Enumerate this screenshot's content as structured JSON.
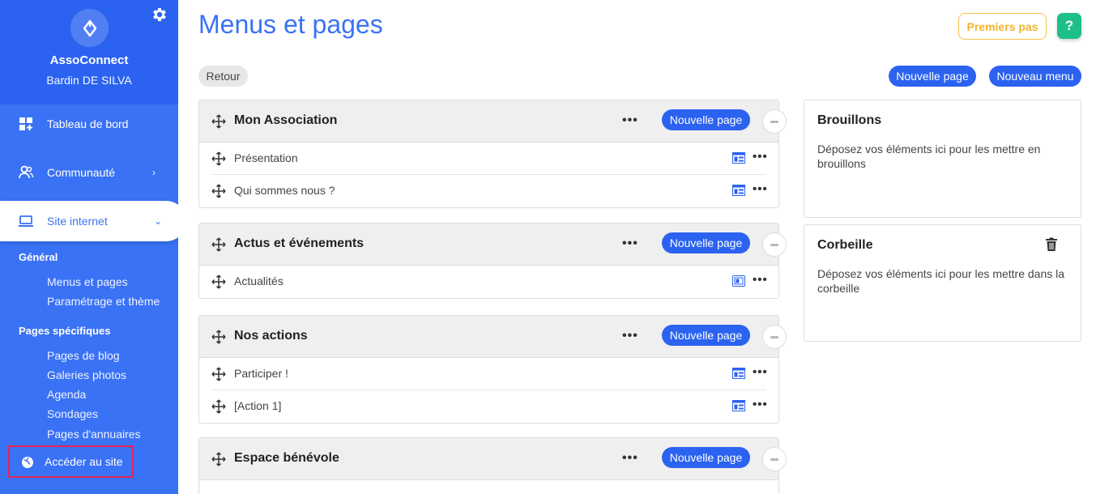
{
  "sidebar": {
    "org_name": "AssoConnect",
    "user_name": "Bardin DE SILVA",
    "nav": [
      {
        "label": "Tableau de bord",
        "icon": "dashboard-icon"
      },
      {
        "label": "Communauté",
        "icon": "community-icon"
      },
      {
        "label": "Site internet",
        "icon": "laptop-icon"
      }
    ],
    "section_general": "Général",
    "general_items": [
      "Menus et pages",
      "Paramétrage et thème"
    ],
    "section_specific": "Pages spécifiques",
    "specific_items": [
      "Pages de blog",
      "Galeries photos",
      "Agenda",
      "Sondages",
      "Pages d'annuaires"
    ],
    "visit_site": "Accéder au site"
  },
  "header": {
    "title": "Menus et pages",
    "first_steps": "Premiers pas",
    "help": "?"
  },
  "toolbar": {
    "back": "Retour",
    "new_page": "Nouvelle page",
    "new_menu": "Nouveau menu"
  },
  "menus": [
    {
      "title": "Mon Association",
      "add_label": "Nouvelle page",
      "pages": [
        "Présentation",
        "Qui sommes nous ?"
      ]
    },
    {
      "title": "Actus et événements",
      "add_label": "Nouvelle page",
      "pages": [
        "Actualités"
      ]
    },
    {
      "title": "Nos actions",
      "add_label": "Nouvelle page",
      "pages": [
        "Participer !",
        "[Action 1]"
      ]
    },
    {
      "title": "Espace bénévole",
      "add_label": "Nouvelle page",
      "pages": []
    }
  ],
  "drafts": {
    "title": "Brouillons",
    "description": "Déposez vos éléments ici pour les mettre en brouillons"
  },
  "trash": {
    "title": "Corbeille",
    "description": "Déposez vos éléments ici pour les mettre dans la corbeille"
  },
  "colors": {
    "primary": "#2b63f0",
    "sidebar": "#3a72f5",
    "accent_yellow": "#f0b42a",
    "help_green": "#1fbf8a",
    "highlight_red": "#e3264f"
  }
}
